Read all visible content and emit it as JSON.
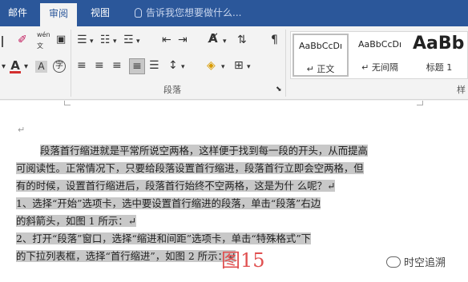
{
  "tabs": [
    {
      "label": "邮件",
      "active": false
    },
    {
      "label": "审阅",
      "active": true
    },
    {
      "label": "视图",
      "active": false
    }
  ],
  "tell_me": "告诉我您想要做什么...",
  "ribbon": {
    "paragraph_group": "段落",
    "styles_group_partial": "样",
    "styles": [
      {
        "sample": "AaBbCcDı",
        "name": "↵ 正文",
        "selected": true
      },
      {
        "sample": "AaBbCcDı",
        "name": "↵ 无间隔",
        "selected": false
      },
      {
        "sample": "AaBb",
        "name": "标题 1",
        "selected": false
      }
    ],
    "font_color_glyph": "A",
    "circle_char_glyph": "字",
    "phonetic_glyph": "wén",
    "text_glyph_a": "A"
  },
  "document": {
    "lines": [
      "段落首行缩进就是平常所说空两格，这样便于找到每一段的开头，从而提高",
      "可阅读性。正常情况下，只要给段落设置首行缩进，段落首行立即会空两格，但",
      "有的时候，设置首行缩进后，段落首行始终不空两格，这是为什 么呢？↵",
      "    1、选择“开始”选项卡，选中要设置首行缩进的段落，单击“段落”右边",
      "的斜箭头，如图 1 所示：↵",
      "    2、打开“段落”窗口，选择“缩进和间距”选项卡，单击“特殊格式”下",
      "的下拉列表框，选择“首行缩进”，如图 2 所示：↵"
    ],
    "figure_label": "图15",
    "watermark": "时空追溯",
    "return_mark": "↵"
  }
}
